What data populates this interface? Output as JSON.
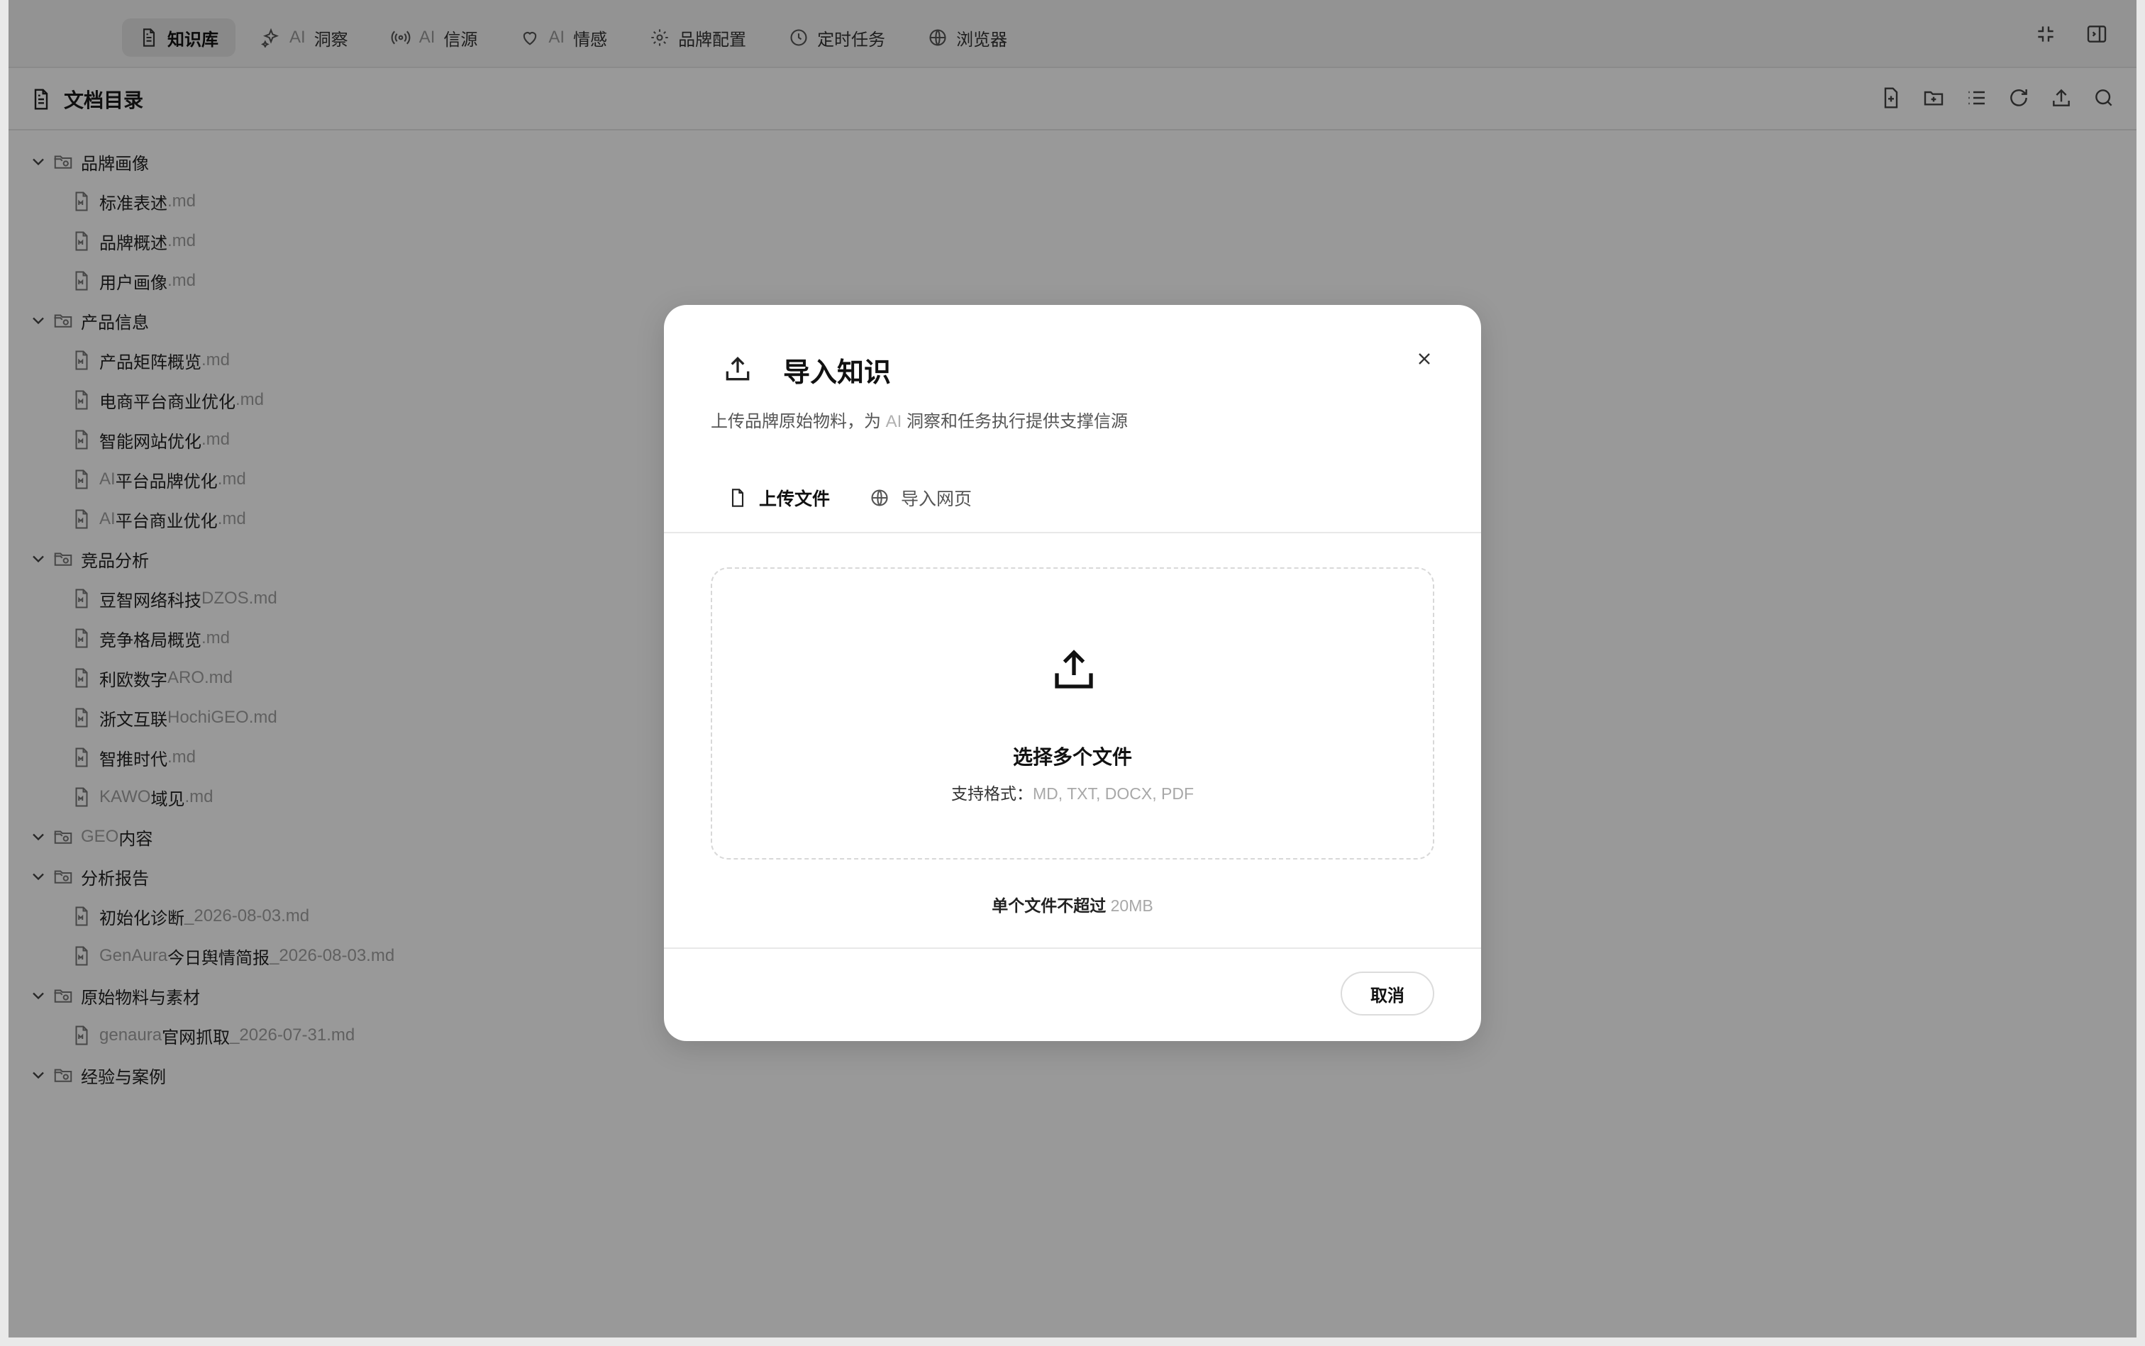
{
  "nav": {
    "items": [
      {
        "label": "知识库",
        "ai": "",
        "icon": "document-icon"
      },
      {
        "label": "洞察",
        "ai": "AI",
        "icon": "sparkle-icon"
      },
      {
        "label": "信源",
        "ai": "AI",
        "icon": "broadcast-icon"
      },
      {
        "label": "情感",
        "ai": "AI",
        "icon": "heart-icon"
      },
      {
        "label": "品牌配置",
        "ai": "",
        "icon": "gear-icon"
      },
      {
        "label": "定时任务",
        "ai": "",
        "icon": "clock-icon"
      },
      {
        "label": "浏览器",
        "ai": "",
        "icon": "globe-icon"
      }
    ]
  },
  "header": {
    "title": "文档目录"
  },
  "tree": {
    "folders": [
      {
        "name": "品牌画像",
        "files": [
          {
            "name": "标准表述",
            "pre": "",
            "ext": ".md"
          },
          {
            "name": "品牌概述",
            "pre": "",
            "ext": ".md"
          },
          {
            "name": "用户画像",
            "pre": "",
            "ext": ".md"
          }
        ]
      },
      {
        "name": "产品信息",
        "files": [
          {
            "name": "产品矩阵概览",
            "pre": "",
            "ext": ".md"
          },
          {
            "name": "电商平台商业优化",
            "pre": "",
            "ext": ".md"
          },
          {
            "name": "智能网站优化",
            "pre": "",
            "ext": ".md"
          },
          {
            "name": "平台品牌优化",
            "pre": "AI",
            "ext": ".md"
          },
          {
            "name": "平台商业优化",
            "pre": "AI",
            "ext": ".md"
          }
        ]
      },
      {
        "name": "竞品分析",
        "files": [
          {
            "name": "豆智网络科技",
            "pre": "",
            "ext": "DZOS.md"
          },
          {
            "name": "竞争格局概览",
            "pre": "",
            "ext": ".md"
          },
          {
            "name": "利欧数字",
            "pre": "",
            "ext": "ARO.md"
          },
          {
            "name": "浙文互联",
            "pre": "",
            "ext": "HochiGEO.md"
          },
          {
            "name": "智推时代",
            "pre": "",
            "ext": ".md"
          },
          {
            "name": "域见",
            "pre": "KAWO",
            "ext": ".md"
          }
        ]
      },
      {
        "name": "内容",
        "pre": "GEO ",
        "files": []
      },
      {
        "name": "分析报告",
        "files": [
          {
            "name": "初始化诊断",
            "pre": "",
            "ext": "_2026-08-03.md"
          },
          {
            "name": "今日舆情简报",
            "pre": "GenAura",
            "ext": "_2026-08-03.md"
          }
        ]
      },
      {
        "name": "原始物料与素材",
        "files": [
          {
            "name": "官网抓取",
            "pre": "genaura",
            "ext": "_2026-07-31.md"
          }
        ]
      },
      {
        "name": "经验与案例",
        "files": []
      }
    ]
  },
  "modal": {
    "title": "导入知识",
    "subtitle_pre": "上传品牌原始物料，为",
    "subtitle_ai": "AI",
    "subtitle_post": "洞察和任务执行提供支撑信源",
    "tabs": [
      {
        "label": "上传文件",
        "icon": "file-icon",
        "active": true
      },
      {
        "label": "导入网页",
        "icon": "globe-icon",
        "active": false
      }
    ],
    "dropzone_title": "选择多个文件",
    "formats_label": "支持格式：",
    "formats_value": "MD, TXT, DOCX, PDF",
    "limit_label": "单个文件不超过",
    "limit_value": "20MB",
    "cancel_label": "取消"
  }
}
